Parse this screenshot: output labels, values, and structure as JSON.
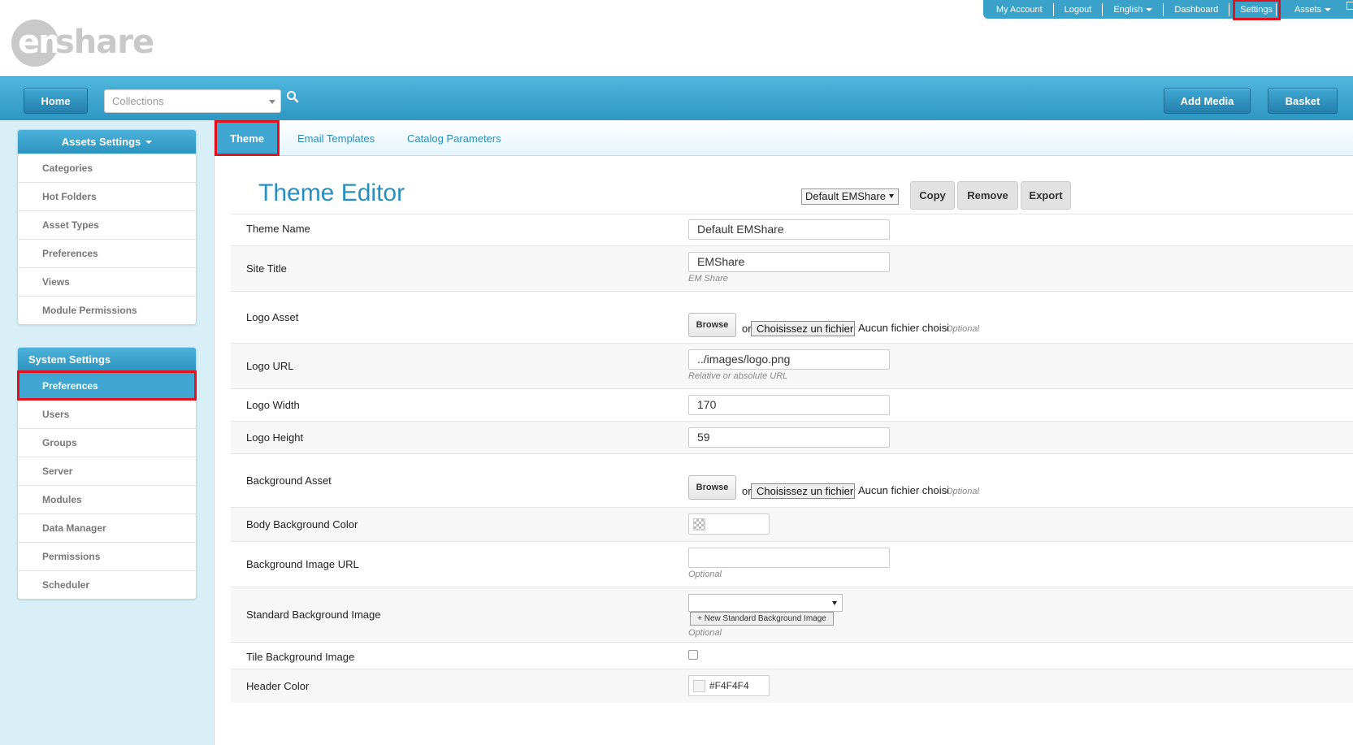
{
  "topbar": {
    "my_account": "My Account",
    "logout": "Logout",
    "language": "English",
    "dashboard": "Dashboard",
    "settings": "Settings",
    "assets": "Assets"
  },
  "logo": {
    "em": "em",
    "share": "share"
  },
  "nav": {
    "home": "Home",
    "collections_value": "Collections",
    "add_media": "Add Media",
    "basket": "Basket"
  },
  "sidebar": {
    "assets_settings_title": "Assets Settings",
    "assets_items": [
      "Categories",
      "Hot Folders",
      "Asset Types",
      "Preferences",
      "Views",
      "Module Permissions"
    ],
    "system_settings_title": "System Settings",
    "system_items": [
      "Preferences",
      "Users",
      "Groups",
      "Server",
      "Modules",
      "Data Manager",
      "Permissions",
      "Scheduler"
    ],
    "active_item": "Preferences"
  },
  "tabs": {
    "theme": "Theme",
    "email_templates": "Email Templates",
    "catalog_parameters": "Catalog Parameters",
    "active": "Theme"
  },
  "editor": {
    "title": "Theme Editor",
    "theme_select": "Default EMShare",
    "copy": "Copy",
    "remove": "Remove",
    "export": "Export"
  },
  "form": {
    "theme_name": {
      "label": "Theme Name",
      "value": "Default EMShare"
    },
    "site_title": {
      "label": "Site Title",
      "value": "EMShare",
      "hint": "EM Share"
    },
    "logo_asset": {
      "label": "Logo Asset",
      "browse": "Browse",
      "or": "or",
      "file_button": "Choisissez un fichier",
      "no_file": "Aucun fichier choisi",
      "optional": "Optional"
    },
    "logo_url": {
      "label": "Logo URL",
      "value": "../images/logo.png",
      "hint": "Relative or absolute URL"
    },
    "logo_width": {
      "label": "Logo Width",
      "value": "170"
    },
    "logo_height": {
      "label": "Logo Height",
      "value": "59"
    },
    "background_asset": {
      "label": "Background Asset",
      "browse": "Browse",
      "or": "or",
      "file_button": "Choisissez un fichier",
      "no_file": "Aucun fichier choisi",
      "optional": "Optional"
    },
    "body_background_color": {
      "label": "Body Background Color",
      "value": ""
    },
    "background_image_url": {
      "label": "Background Image URL",
      "value": "",
      "hint": "Optional"
    },
    "standard_background_image": {
      "label": "Standard Background Image",
      "value": "",
      "new_button": "+ New Standard Background Image",
      "hint": "Optional"
    },
    "tile_background_image": {
      "label": "Tile Background Image",
      "checked": false
    },
    "header_color": {
      "label": "Header Color",
      "value": "#F4F4F4"
    }
  },
  "colors": {
    "brand_blue": "#40a7d2",
    "highlight_red": "#e0141e",
    "title_blue": "#2a8fc0"
  }
}
